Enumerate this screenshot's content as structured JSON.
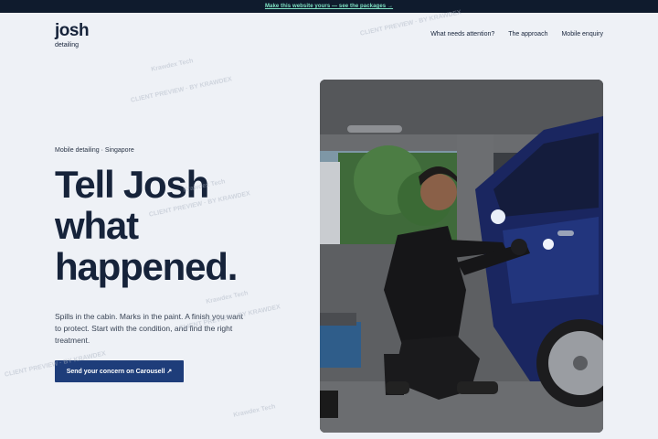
{
  "banner": {
    "text": "Make this website yours — see the packages →"
  },
  "brand": {
    "name": "josh",
    "sub": "detailing"
  },
  "nav": {
    "items": [
      "What needs attention?",
      "The approach",
      "Mobile enquiry"
    ]
  },
  "hero": {
    "eyebrow": "Mobile detailing · Singapore",
    "headline": [
      "Tell Josh",
      "what",
      "happened."
    ],
    "description": "Spills in the cabin. Marks in the paint. A finish you want to protect. Start with the condition, and find the right treatment.",
    "cta_label": "Send your concern on Carousell ↗"
  },
  "watermark": {
    "brand": "Krawdex Tech",
    "caption": "CLIENT PREVIEW · BY KRAWDEX"
  },
  "colors": {
    "accent": "#1e3d7a",
    "banner_bg": "#0f1b2d",
    "banner_link": "#7fe3c4",
    "page_bg": "#eef1f6",
    "ink": "#16233a"
  }
}
